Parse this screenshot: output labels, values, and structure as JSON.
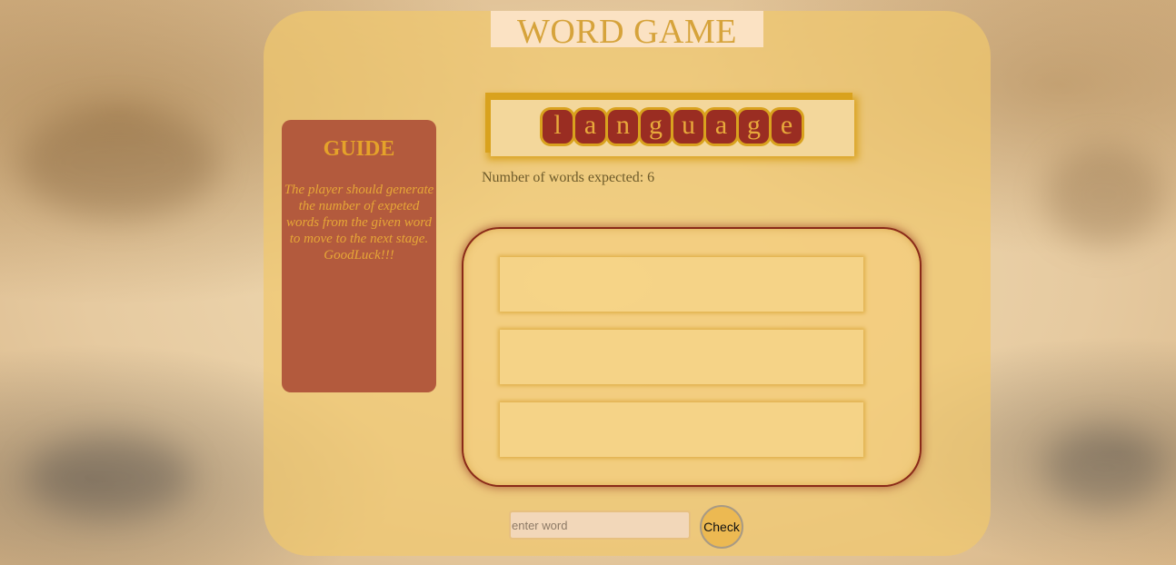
{
  "title": "WORD GAME",
  "guide": {
    "heading": "GUIDE",
    "text": "The player should generate the number of expeted words from the given word to move to the next stage. GoodLuck!!!"
  },
  "word": {
    "letters": [
      "l",
      "a",
      "n",
      "g",
      "u",
      "a",
      "g",
      "e"
    ]
  },
  "expected_text": "Number of words expected: 6",
  "answer_slots": [
    "",
    "",
    ""
  ],
  "input": {
    "placeholder": "enter word",
    "value": ""
  },
  "check_label": "Check",
  "colors": {
    "panel": "#f0c86e",
    "guide_bg": "#b35a3d",
    "tile_bg": "#9a2d22",
    "gold": "#d9a21e",
    "button": "#ecb952"
  }
}
